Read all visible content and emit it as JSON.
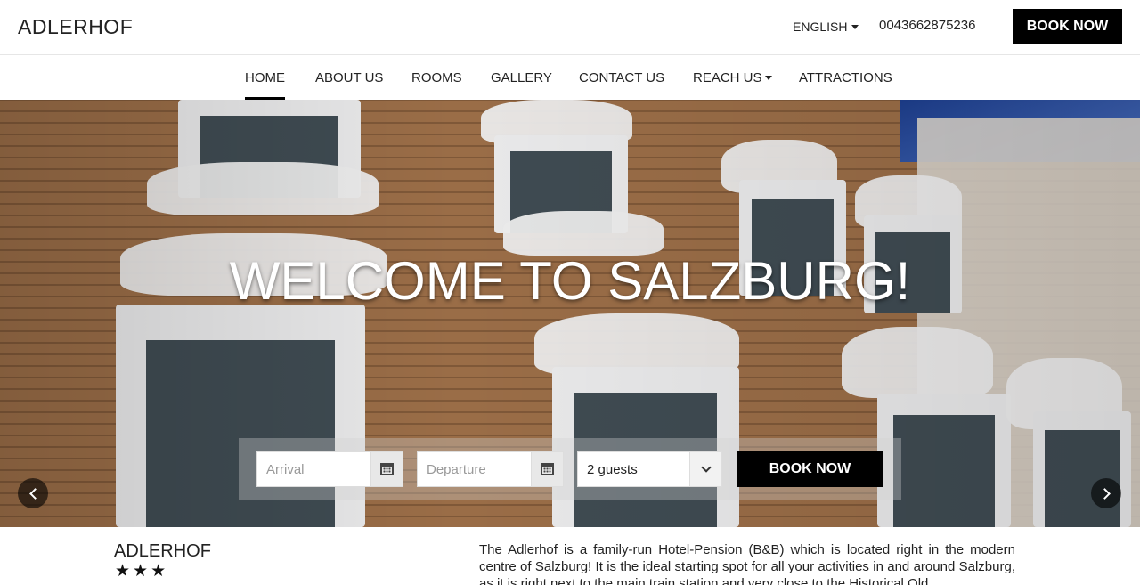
{
  "header": {
    "brand": "ADLERHOF",
    "language": "ENGLISH",
    "phone": "0043662875236",
    "book_now": "BOOK NOW"
  },
  "nav": {
    "items": [
      {
        "label": "HOME",
        "active": true
      },
      {
        "label": "ABOUT US"
      },
      {
        "label": "ROOMS"
      },
      {
        "label": "GALLERY"
      },
      {
        "label": "CONTACT US"
      },
      {
        "label": "REACH US",
        "dropdown": true
      },
      {
        "label": "ATTRACTIONS"
      }
    ]
  },
  "hero": {
    "title": "WELCOME TO SALZBURG!",
    "booking": {
      "arrival_placeholder": "Arrival",
      "departure_placeholder": "Departure",
      "guests_value": "2 guests",
      "book_now": "BOOK NOW"
    }
  },
  "about": {
    "name": "ADLERHOF",
    "stars": "★★★",
    "text": "The Adlerhof is a family-run Hotel-Pension (B&B) which is located right in the modern centre of Salzburg! It is the ideal starting spot for all your activities in and around Salzburg, as it is right next to the main train station and very close to the Historical Old"
  },
  "colors": {
    "accent": "#000000",
    "text": "#222222"
  }
}
